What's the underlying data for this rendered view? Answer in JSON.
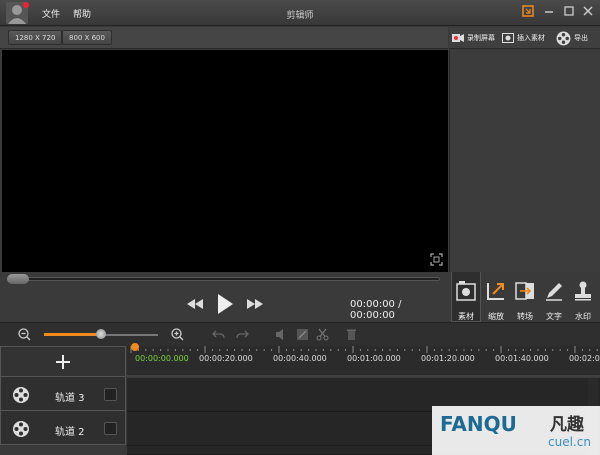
{
  "app": {
    "title": "剪辑师"
  },
  "menu": {
    "file": "文件",
    "help": "帮助"
  },
  "resolutions": [
    "1280 X 720",
    "800 X 600"
  ],
  "toolbar_right": {
    "record": "录制屏幕",
    "insert": "插入素材",
    "export": "导出"
  },
  "player": {
    "timecode": "00:00:00 / 00:00:00",
    "seek_progress": 0
  },
  "tabs": [
    {
      "label": "素材",
      "icon": "material-icon",
      "active": true
    },
    {
      "label": "缩放",
      "icon": "zoom-crop-icon",
      "active": false
    },
    {
      "label": "转场",
      "icon": "transition-icon",
      "active": false
    },
    {
      "label": "文字",
      "icon": "text-pen-icon",
      "active": false
    },
    {
      "label": "水印",
      "icon": "stamp-icon",
      "active": false
    }
  ],
  "timeline": {
    "zoom_level": 0.5,
    "current_time": "00:00:00.000",
    "ticks": [
      "00:00:20.000",
      "00:00:40.000",
      "00:01:00.000",
      "00:01:20.000",
      "00:01:40.000",
      "00:02:0"
    ],
    "tracks": [
      {
        "name": "轨道 3"
      },
      {
        "name": "轨道 2"
      }
    ]
  },
  "watermark": {
    "text": "FANQU",
    "cn": "凡趣",
    "sub": "cuel.cn"
  },
  "colors": {
    "accent": "#f08a1c",
    "current_time": "#7dd33a"
  }
}
